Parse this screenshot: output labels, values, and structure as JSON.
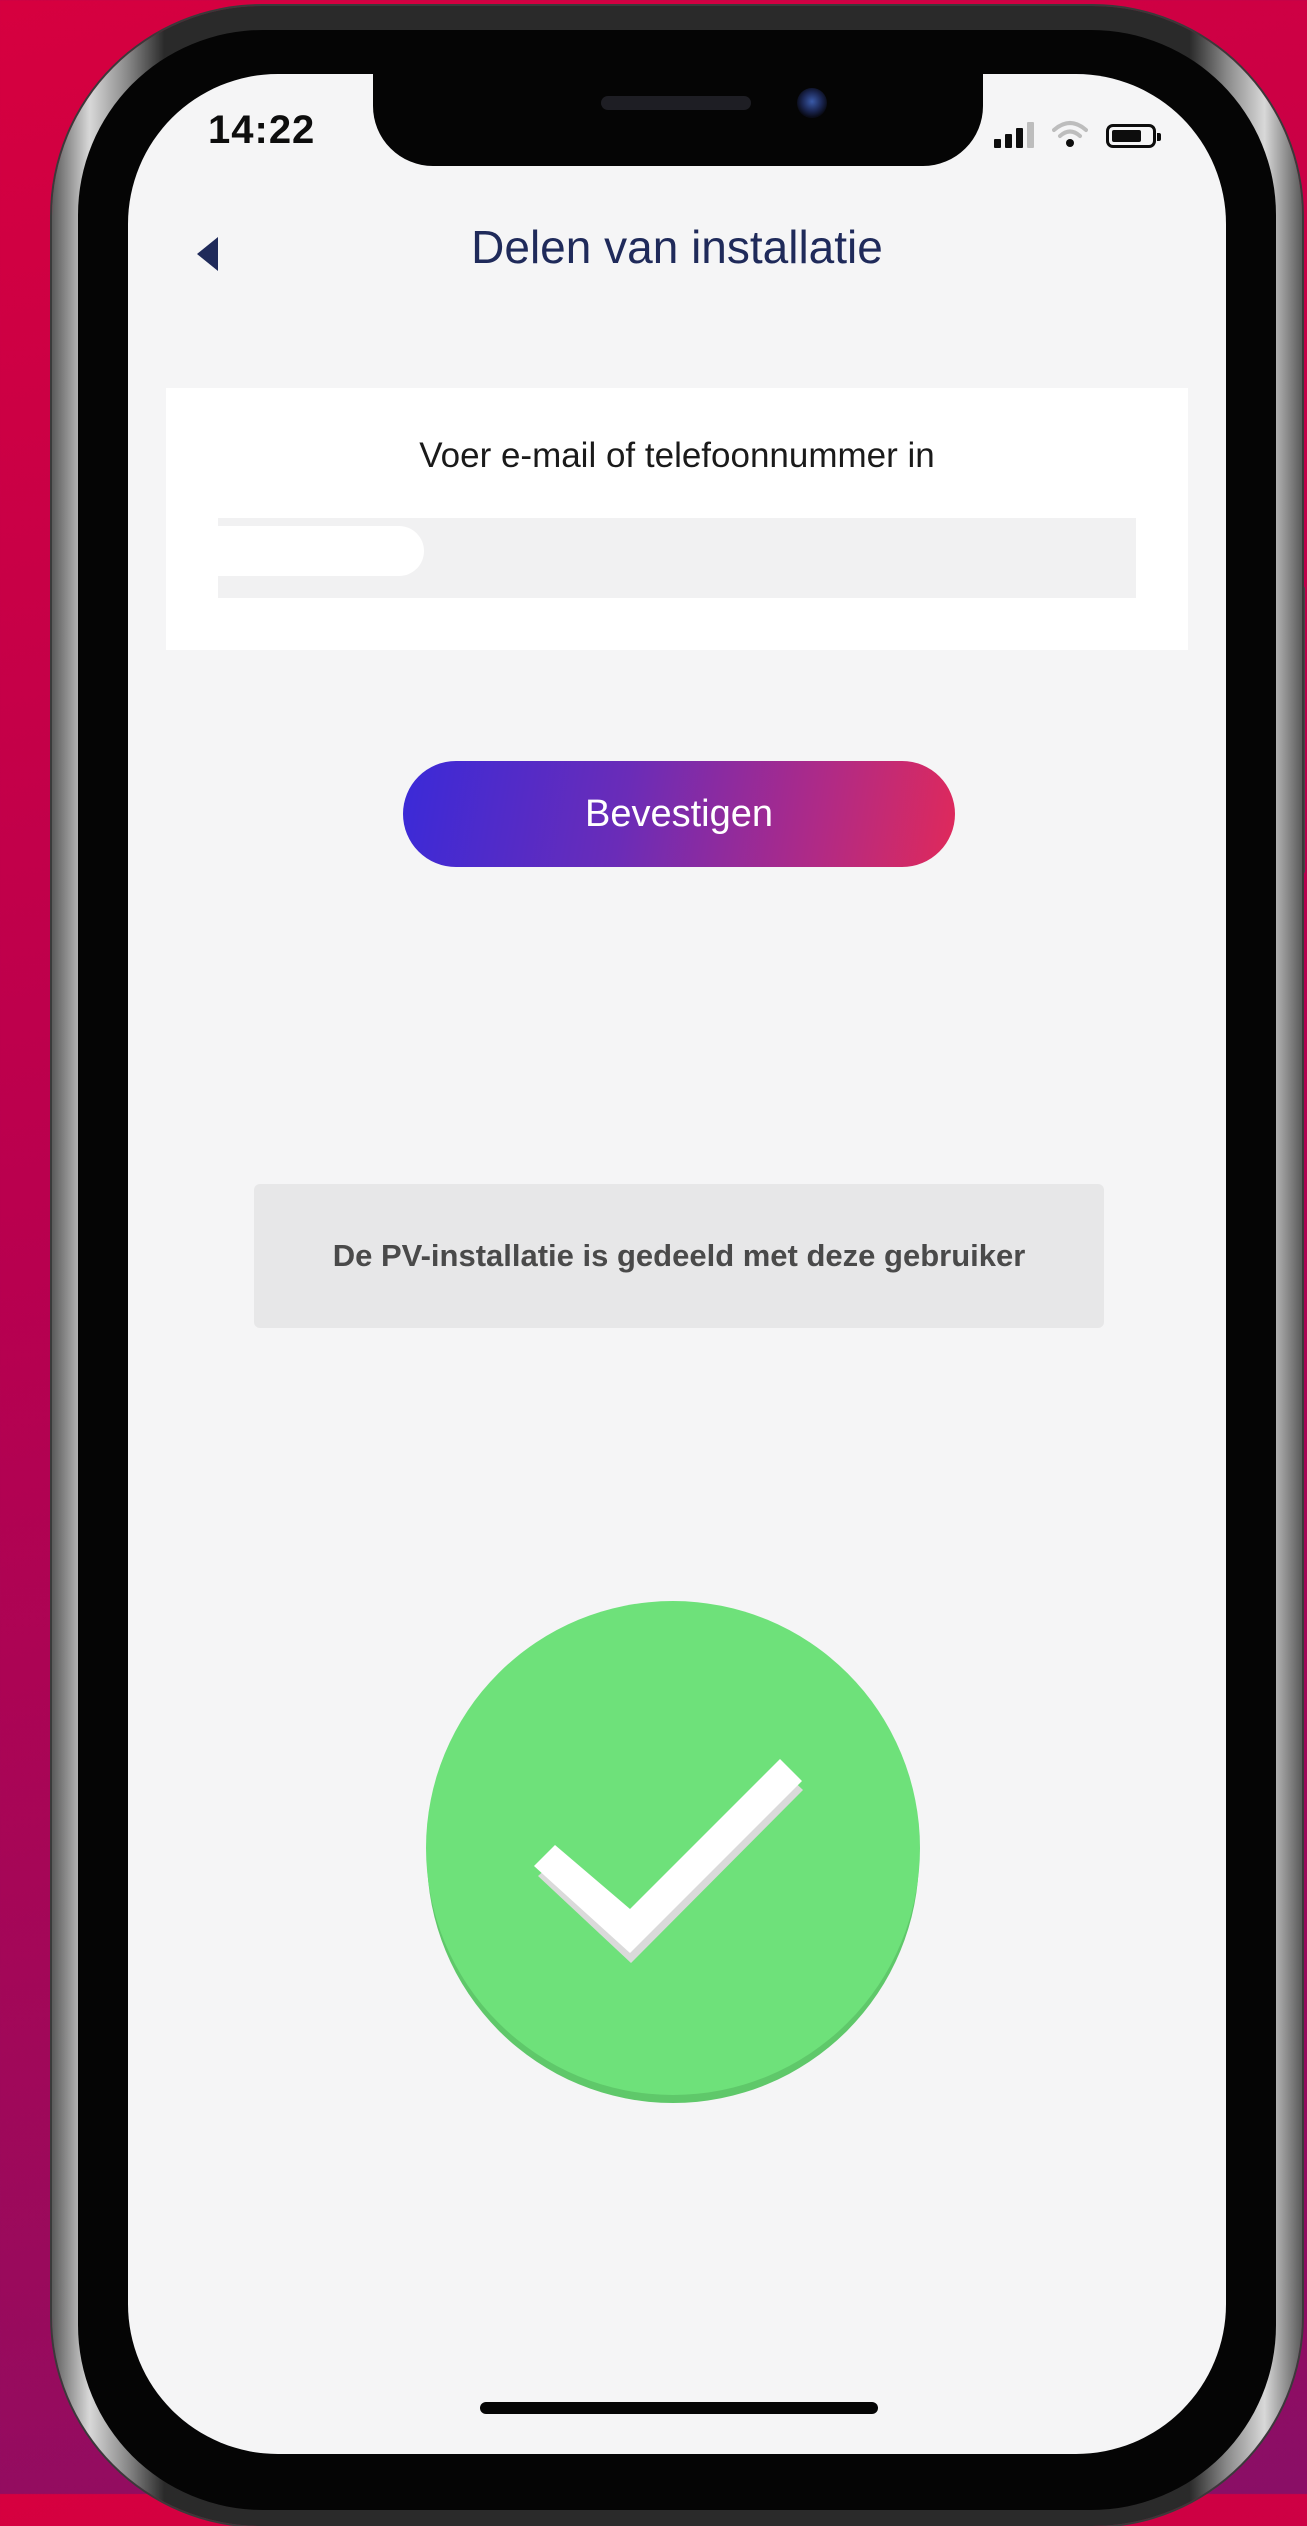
{
  "status_bar": {
    "time": "14:22",
    "signal_icon": "cellular-signal-icon",
    "wifi_icon": "wifi-icon",
    "battery_icon": "battery-icon",
    "battery_level": 0.75
  },
  "header": {
    "back_icon": "back-arrow-icon",
    "title": "Delen van installatie"
  },
  "form": {
    "label": "Voer e-mail of telefoonnummer in",
    "input_value": "",
    "confirm_label": "Bevestigen"
  },
  "toast": {
    "message": "De PV-installatie is gedeeld met deze gebruiker"
  },
  "success": {
    "icon": "checkmark-circle-icon"
  },
  "colors": {
    "background_top": "#d6003f",
    "background_bottom": "#8a0e66",
    "title_text": "#1f2a5a",
    "button_gradient_start": "#3a2ad8",
    "button_gradient_end": "#e0295a",
    "success_green": "#6ee17a"
  }
}
